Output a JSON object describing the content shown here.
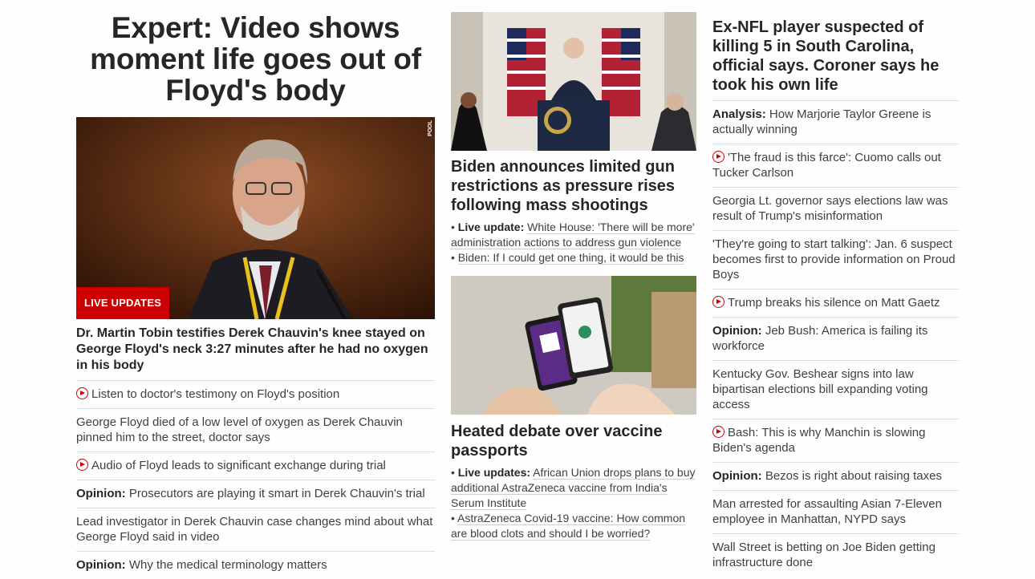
{
  "lead": {
    "banner": "Expert: Video shows moment life goes out of Floyd's body",
    "badge": "LIVE UPDATES",
    "pool_credit": "POOL",
    "headline": "Dr. Martin Tobin testifies Derek Chauvin's knee stayed on George Floyd's neck 3:27 minutes after he had no oxygen in his body",
    "items": [
      {
        "video": true,
        "prefix": "",
        "text": "Listen to doctor's testimony on Floyd's position"
      },
      {
        "video": false,
        "prefix": "",
        "text": "George Floyd died of a low level of oxygen as Derek Chauvin pinned him to the street, doctor says"
      },
      {
        "video": true,
        "prefix": "",
        "text": "Audio of Floyd leads to significant exchange during trial"
      },
      {
        "video": false,
        "prefix": "Opinion:",
        "text": "Prosecutors are playing it smart in Derek Chauvin's trial"
      },
      {
        "video": false,
        "prefix": "",
        "text": "Lead investigator in Derek Chauvin case changes mind about what George Floyd said in video"
      },
      {
        "video": false,
        "prefix": "Opinion:",
        "text": "Why the medical terminology matters"
      }
    ]
  },
  "story2": {
    "headline": "Biden announces limited gun restrictions as pressure rises following mass shootings",
    "bullet1_prefix": "Live update:",
    "bullet1_text": "White House: 'There will be more' administration actions to address gun violence",
    "bullet2_text": "Biden: If I could get one thing, it would be this"
  },
  "story3": {
    "headline": "Heated debate over vaccine passports",
    "bullet1_prefix": "Live updates:",
    "bullet1_text": "African Union drops plans to buy additional AstraZeneca vaccine from India's Serum Institute",
    "bullet2_text": "AstraZeneca Covid-19 vaccine: How common are blood clots and should I be worried?"
  },
  "right": {
    "headline": "Ex-NFL player suspected of killing 5 in South Carolina, official says. Coroner says he took his own life",
    "items": [
      {
        "video": false,
        "prefix": "Analysis:",
        "text": "How Marjorie Taylor Greene is actually winning"
      },
      {
        "video": true,
        "prefix": "",
        "text": "'The fraud is this farce': Cuomo calls out Tucker Carlson"
      },
      {
        "video": false,
        "prefix": "",
        "text": "Georgia Lt. governor says elections law was result of Trump's misinformation"
      },
      {
        "video": false,
        "prefix": "",
        "text": "'They're going to start talking': Jan. 6 suspect becomes first to provide information on Proud Boys"
      },
      {
        "video": true,
        "prefix": "",
        "text": "Trump breaks his silence on Matt Gaetz"
      },
      {
        "video": false,
        "prefix": "Opinion:",
        "text": "Jeb Bush: America is failing its workforce"
      },
      {
        "video": false,
        "prefix": "",
        "text": "Kentucky Gov. Beshear signs into law bipartisan elections bill expanding voting access"
      },
      {
        "video": true,
        "prefix": "",
        "text": "Bash: This is why Manchin is slowing Biden's agenda"
      },
      {
        "video": false,
        "prefix": "Opinion:",
        "text": "Bezos is right about raising taxes"
      },
      {
        "video": false,
        "prefix": "",
        "text": "Man arrested for assaulting Asian 7-Eleven employee in Manhattan, NYPD says"
      },
      {
        "video": false,
        "prefix": "",
        "text": "Wall Street is betting on Joe Biden getting infrastructure done"
      }
    ]
  },
  "colors": {
    "accent": "#cc0000",
    "text": "#262626",
    "divider": "#dedede"
  }
}
